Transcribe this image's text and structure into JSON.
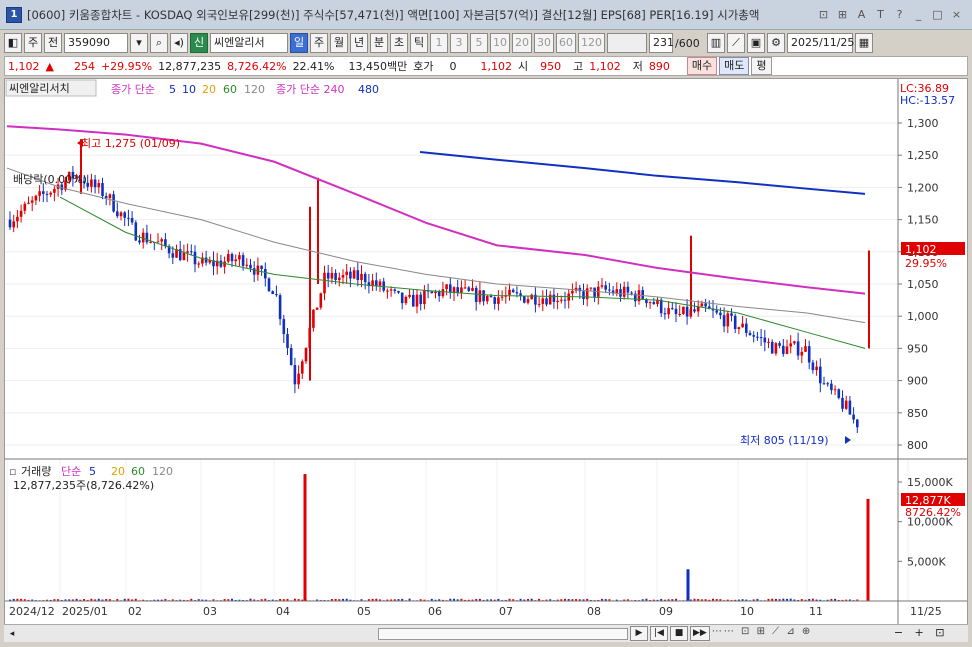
{
  "window": {
    "number": "1",
    "title": "[0600] 키움종합차트 - KOSDAQ 외국인보유[299(천)] 주식수[57,471(천)] 액면[100] 자본금[57(억)] 결산[12월] EPS[68] PER[16.19] 시가총액",
    "controls": [
      "⊡",
      "⊞",
      "A",
      "T",
      "?",
      "_",
      "□",
      "×"
    ]
  },
  "toolbar": {
    "period_short": "주",
    "market": "전",
    "code": "359090",
    "badge": "신",
    "stock_name": "씨엔알리서",
    "periods": [
      "일",
      "주",
      "월",
      "년",
      "분",
      "초",
      "틱"
    ],
    "selected_period": "일",
    "intervals": [
      "1",
      "3",
      "5",
      "10",
      "20",
      "30",
      "60",
      "120"
    ],
    "count": "231",
    "count_total": "/600",
    "date": "2025/11/25"
  },
  "price_line": {
    "price": "1,102",
    "change": "254",
    "change_pct": "+29.95%",
    "volume": "12,877,235",
    "volume_pct": "8,726.42%",
    "turnover": "22.41%",
    "amount": "13,450백만",
    "hoga_label": "호가",
    "hoga": "0",
    "hoga_price": "1,102",
    "open_label": "시",
    "open": "950",
    "high_label": "고",
    "high": "1,102",
    "low_label": "저",
    "low": "890",
    "buy": "매수",
    "sell": "매도",
    "flat": "평"
  },
  "price_panel": {
    "name": "씨엔알리서치",
    "ma_label": "종가 단순",
    "ma_periods": [
      "5",
      "10",
      "20",
      "60",
      "120"
    ],
    "ma_long_label": "종가 단순 240",
    "ma_long_extra": "480",
    "lc": "LC:36.89",
    "hc": "HC:-13.57",
    "high_note": "최고 1,275 (01/09)",
    "low_note": "최저 805 (11/19)",
    "dividend": "배당락(0.00%)",
    "current_tag": "1,102",
    "current_pct": "29.95%",
    "yticks": [
      "1,300",
      "1,250",
      "1,200",
      "1,150",
      "1,100",
      "1,050",
      "1,000",
      "950",
      "900",
      "850",
      "800"
    ]
  },
  "volume_panel": {
    "label": "거래량",
    "ma_label": "단순",
    "ma_periods": [
      "5",
      "20",
      "60",
      "120"
    ],
    "value_text": "12,877,235주(8,726.42%)",
    "current_tag": "12,877K",
    "current_pct": "8726.42%",
    "yticks": [
      "15,000K",
      "10,000K",
      "5,000K"
    ]
  },
  "xaxis": {
    "labels": [
      "2024/12",
      "2025/01",
      "02",
      "03",
      "04",
      "05",
      "06",
      "07",
      "08",
      "09",
      "10",
      "11",
      "11/25"
    ]
  },
  "colors": {
    "up": "#e00000",
    "down": "#1030c0",
    "ma5": "#1030c0",
    "ma20": "#e0a000",
    "ma60": "#2a8a2a",
    "ma120": "#888888",
    "ma240": "#d030c0",
    "ma480": "#1030c0"
  },
  "chart_data": {
    "type": "line",
    "title": "씨엔알리서치",
    "ylim": [
      790,
      1320
    ],
    "series": [
      {
        "name": "종가 단순 240",
        "x": [
          "2024/12",
          "2025/01",
          "02",
          "03",
          "04",
          "05",
          "06",
          "07",
          "08",
          "09",
          "10",
          "11",
          "11/25"
        ],
        "values": [
          1295,
          1290,
          1282,
          1268,
          1240,
          1190,
          1145,
          1110,
          1095,
          1075,
          1058,
          1045,
          1035
        ]
      },
      {
        "name": "480",
        "x": [
          "06",
          "07",
          "08",
          "09",
          "10",
          "11",
          "11/25"
        ],
        "values": [
          1255,
          1243,
          1230,
          1218,
          1208,
          1198,
          1190
        ]
      },
      {
        "name": "120",
        "x": [
          "2024/12",
          "2025/01",
          "02",
          "03",
          "04",
          "05",
          "06",
          "07",
          "08",
          "09",
          "10",
          "11",
          "11/25"
        ],
        "values": [
          1230,
          1200,
          1175,
          1150,
          1115,
          1085,
          1065,
          1050,
          1040,
          1030,
          1015,
          1005,
          990
        ]
      },
      {
        "name": "60",
        "x": [
          "2025/01",
          "02",
          "03",
          "04",
          "05",
          "06",
          "07",
          "08",
          "09",
          "10",
          "11",
          "11/25"
        ],
        "values": [
          1185,
          1130,
          1090,
          1065,
          1050,
          1040,
          1032,
          1030,
          1025,
          1005,
          975,
          950
        ]
      }
    ],
    "volume_spikes": [
      {
        "date": "04",
        "value": 16000
      },
      {
        "date": "09",
        "value": 4000
      },
      {
        "date": "11/25",
        "value": 12877
      }
    ]
  }
}
